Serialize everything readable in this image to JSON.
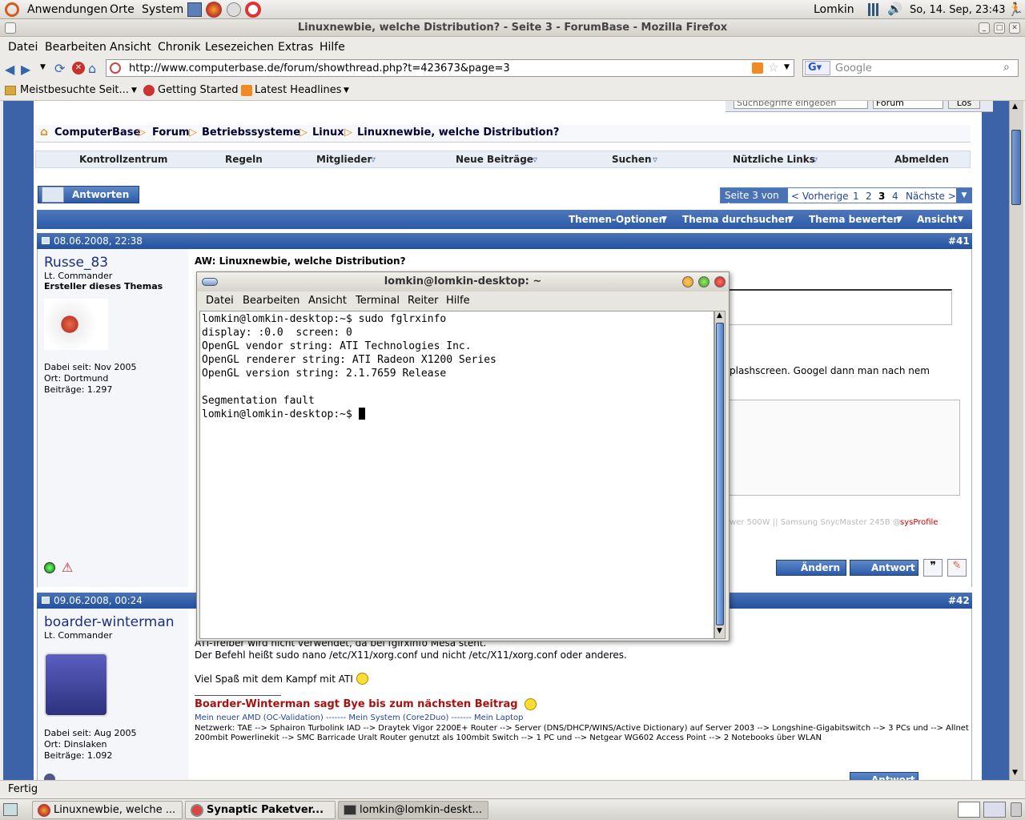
{
  "panel": {
    "apps": "Anwendungen",
    "places": "Orte",
    "system": "System",
    "user": "Lomkin",
    "clock": "So, 14. Sep, 23:43"
  },
  "window": {
    "title": "Linuxnewbie, welche Distribution? - Seite 3 - ForumBase - Mozilla Firefox"
  },
  "menu": {
    "datei": "Datei",
    "bearbeiten": "Bearbeiten",
    "ansicht": "Ansicht",
    "chronik": "Chronik",
    "lesezeichen": "Lesezeichen",
    "extras": "Extras",
    "hilfe": "Hilfe"
  },
  "nav": {
    "url": "http://www.computerbase.de/forum/showthread.php?t=423673&page=3",
    "search_placeholder": "Google"
  },
  "bookmarks": [
    "Meistbesuchte Seit...",
    "Getting Started",
    "Latest Headlines"
  ],
  "site": {
    "search_placeholder": "Suchbegriffe eingeben",
    "search_scope": "Forum",
    "search_button": "Los",
    "breadcrumb": [
      "ComputerBase",
      "Forum",
      "Betriebssysteme",
      "Linux",
      "Linuxnewbie, welche Distribution?"
    ],
    "navlinks": [
      "Kontrollzentrum",
      "Regeln",
      "Mitglieder",
      "Neue Beiträge",
      "Suchen",
      "Nützliche Links",
      "Abmelden"
    ],
    "reply_button": "Antworten",
    "pager": {
      "label": "Seite 3 von 4",
      "prev": "< Vorherige",
      "pages": [
        "1",
        "2",
        "3",
        "4"
      ],
      "next": "Nächste >"
    },
    "thread_tools": [
      "Themen-Optionen",
      "Thema durchsuchen",
      "Thema bewerten",
      "Ansicht"
    ]
  },
  "posts": [
    {
      "date": "08.06.2008, 22:38",
      "num": "#41",
      "user": "Russe_83",
      "rank": "Lt. Commander",
      "role": "Ersteller dieses Themas",
      "joined": "Dabei seit: Nov 2005",
      "location": "Ort: Dortmund",
      "posts": "Beiträge: 1.297",
      "title": "AW: Linuxnewbie, welche Distribution?",
      "body_fragment": "plashscreen. Googel dann man nach nem",
      "sig_fragment": "wer 500W || Samsung SnycMaster 245B @",
      "sysprofile": "sysProfile",
      "edit_button": "Ändern",
      "reply_button": "Antwort"
    },
    {
      "date": "09.06.2008, 00:24",
      "num": "#42",
      "user": "boarder-winterman",
      "rank": "Lt. Commander",
      "joined": "Dabei seit: Aug 2005",
      "location": "Ort: Dinslaken",
      "posts": "Beiträge: 1.092",
      "line1": "ATI-Treiber wird nicht verwendet, da bei fglrxinfo Mesa steht.",
      "line2": "Der Befehl heißt sudo nano /etc/X11/xorg.conf und nicht /etc/X11/xorg.conf oder anderes.",
      "line3": "Viel Spaß mit dem Kampf mit ATI",
      "sig_title": "Boarder-Winterman sagt Bye bis zum nächsten Beitrag",
      "sig_links": "Mein neuer AMD (OC-Validation) ------- Mein System (Core2Duo) ------- Mein Laptop",
      "sig_net1": "Netzwerk: TAE --> Sphairon Turbolink IAD --> Draytek Vigor 2200E+ Router --> Server (DNS/DHCP/WINS/Active Dictionary) auf Server 2003 --> Longshine-Gigabitswitch --> 3 PCs und --> Allnet",
      "sig_net2": "200mbit Powerlinekit --> SMC Barricade Uralt Router genutzt als 100mbit Switch --> 1 PC und --> Netgear WG602 Access Point --> 2 Notebooks über WLAN",
      "reply_button": "Antwort"
    }
  ],
  "terminal": {
    "title": "lomkin@lomkin-desktop: ~",
    "menu": [
      "Datei",
      "Bearbeiten",
      "Ansicht",
      "Terminal",
      "Reiter",
      "Hilfe"
    ],
    "lines": [
      "lomkin@lomkin-desktop:~$ sudo fglrxinfo",
      "display: :0.0  screen: 0",
      "OpenGL vendor string: ATI Technologies Inc.",
      "OpenGL renderer string: ATI Radeon X1200 Series",
      "OpenGL version string: 2.1.7659 Release",
      "",
      "Segmentation fault",
      "lomkin@lomkin-desktop:~$ "
    ]
  },
  "status": "Fertig",
  "taskbar": [
    "Linuxnewbie, welche ...",
    "Synaptic Paketver...",
    "lomkin@lomkin-deskt..."
  ]
}
